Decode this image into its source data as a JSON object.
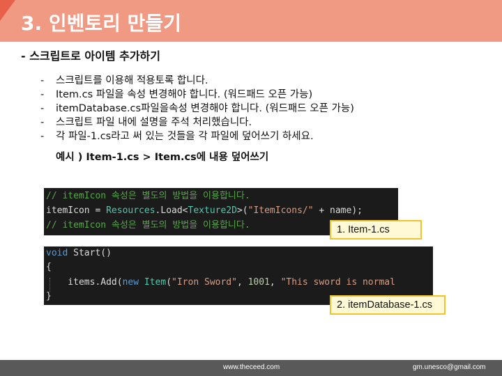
{
  "header": {
    "title": "3. 인벤토리 만들기"
  },
  "subtitle": "- 스크립트로 아이템 추가하기",
  "bullets": [
    {
      "dash": "-",
      "text": "스크립트를 이용해 적용토록 합니다."
    },
    {
      "dash": "-",
      "text": "Item.cs 파일을 속성 변경해야 합니다. (워드패드 오픈 가능)"
    },
    {
      "dash": "-",
      "text": "itemDatabase.cs파일을속성 변경해야 합니다. (워드패드 오픈 가능)"
    },
    {
      "dash": "-",
      "text": "스크립트 파일 내에 설명을 주석 처리했습니다."
    },
    {
      "dash": "-",
      "text": "각 파일-1.cs라고 써 있는 것들을 각 파일에 덮어쓰기 하세요."
    }
  ],
  "example": "예시 ) Item-1.cs > Item.cs에 내용 덮어쓰기",
  "code1": {
    "line1": "// itemIcon 속성은 별도의 방법을 이용합니다.",
    "line2": {
      "a": "itemIcon = ",
      "b": "Resources",
      "c": ".Load<",
      "d": "Texture2D",
      "e": ">(",
      "f": "\"ItemIcons/\"",
      "g": " + name);"
    },
    "line3": "// itemIcon 속성은 별도의 방법을 이용합니다."
  },
  "code2": {
    "line1": {
      "kw": "void",
      "rest": " Start()"
    },
    "line2": "{",
    "line3": {
      "a": "    items.Add(",
      "b": "new",
      "c": " ",
      "d": "Item",
      "e": "(",
      "f": "\"Iron Sword\"",
      "g": ", ",
      "h": "1001",
      "i": ", ",
      "j": "\"This sword is normal"
    },
    "line4": "}"
  },
  "labels": {
    "label1": "1. Item-1.cs",
    "label2": "2. itemDatabase-1.cs"
  },
  "footer": {
    "url": "www.theceed.com",
    "email": "gm.unesco@gmail.com"
  }
}
